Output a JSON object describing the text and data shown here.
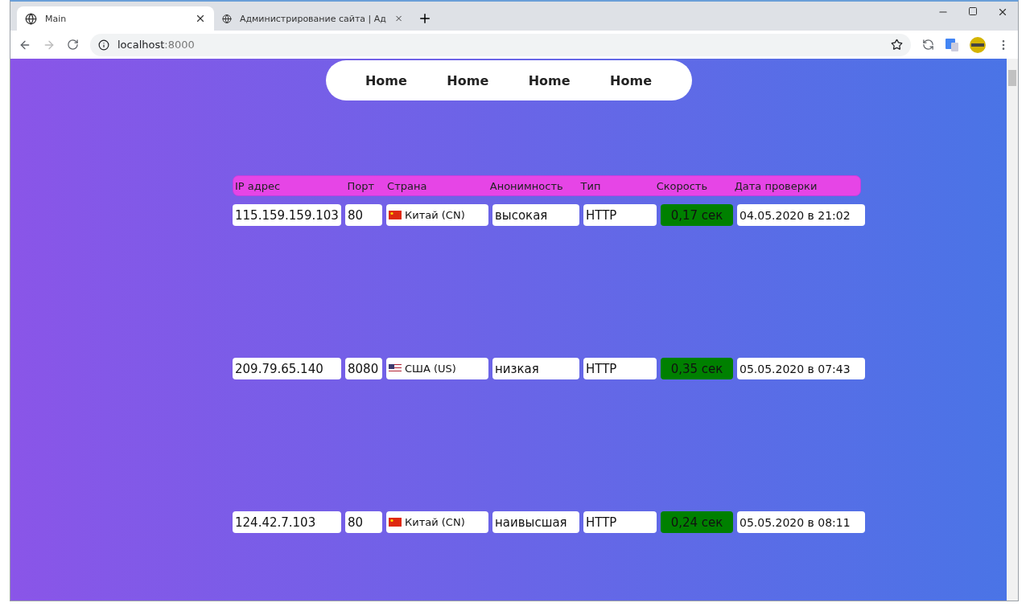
{
  "browser": {
    "tabs": [
      {
        "title": "Main",
        "selected": true
      },
      {
        "title": "Администрирование сайта | Ад",
        "selected": false
      }
    ],
    "address": {
      "host": "localhost",
      "port": ":8000"
    }
  },
  "nav": {
    "items": [
      "Home",
      "Home",
      "Home",
      "Home"
    ]
  },
  "table": {
    "columns": [
      "IP адрес",
      "Порт",
      "Страна",
      "Анонимность",
      "Тип",
      "Скорость",
      "Дата проверки"
    ],
    "rows": [
      {
        "ip": "115.159.159.103",
        "port": "80",
        "kind": "cn",
        "country": "Китай (CN)",
        "anonymity": "высокая",
        "type": "HTTP",
        "speed": "0,17 сек",
        "date": "04.05.2020 в 21:02"
      },
      {
        "ip": "209.79.65.140",
        "port": "8080",
        "kind": "us",
        "country": "США (US)",
        "anonymity": "низкая",
        "type": "HTTP",
        "speed": "0,35 сек",
        "date": "05.05.2020 в 07:43"
      },
      {
        "ip": "124.42.7.103",
        "port": "80",
        "kind": "cn",
        "country": "Китай (CN)",
        "anonymity": "наивысшая",
        "type": "HTTP",
        "speed": "0,24 сек",
        "date": "05.05.2020 в 08:11"
      }
    ]
  }
}
